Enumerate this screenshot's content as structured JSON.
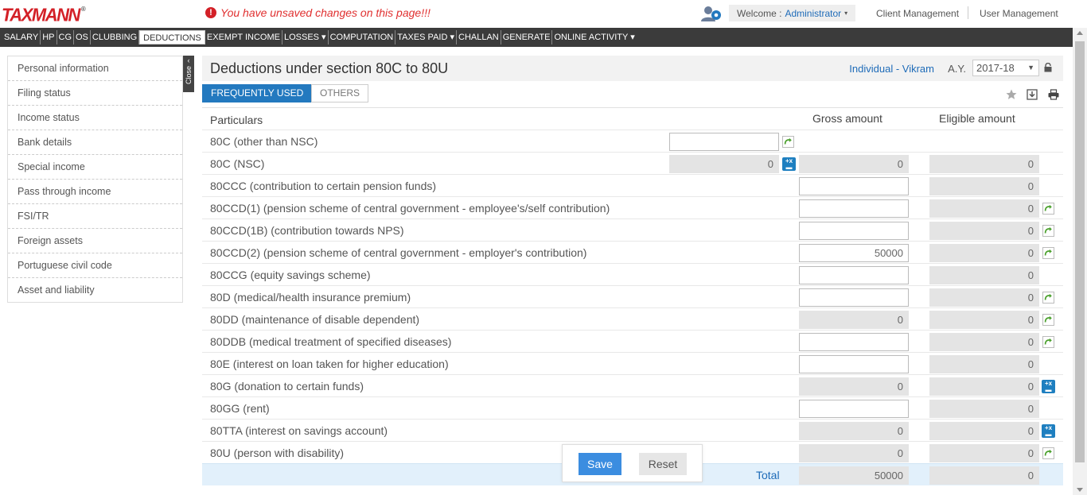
{
  "brand": {
    "logo": "TAXMANN",
    "reg": "®",
    "accent": "#d32027"
  },
  "header": {
    "warning": "You have unsaved changes on this page!!!",
    "welcome_prefix": "Welcome :",
    "user": "Administrator",
    "links": [
      "Client Management",
      "User Management"
    ]
  },
  "nav": {
    "items": [
      "SALARY",
      "HP",
      "CG",
      "OS",
      "CLUBBING",
      "DEDUCTIONS",
      "EXEMPT INCOME",
      "LOSSES ▾",
      "COMPUTATION",
      "TAXES PAID ▾",
      "CHALLAN",
      "GENERATE",
      "ONLINE ACTIVITY ▾"
    ],
    "active": "DEDUCTIONS"
  },
  "sidebar": {
    "items": [
      "Personal information",
      "Filing status",
      "Income status",
      "Bank details",
      "Special income",
      "Pass through income",
      "FSI/TR",
      "Foreign assets",
      "Portuguese civil code",
      "Asset and liability"
    ],
    "close_label": "Close"
  },
  "main": {
    "title": "Deductions under section 80C to 80U",
    "assessee": "Individual - Vikram",
    "ay_label": "A.Y.",
    "ay_value": "2017-18",
    "tabs": [
      "FREQUENTLY USED",
      "OTHERS"
    ]
  },
  "table": {
    "headers": {
      "particulars": "Particulars",
      "gross": "Gross amount",
      "eligible": "Eligible amount"
    },
    "rows": [
      {
        "label": "80C (other than NSC)",
        "claim": "",
        "gross": null,
        "eligible": null
      },
      {
        "label": "80C (NSC)",
        "claim": "0",
        "gross": "0",
        "eligible": "0"
      },
      {
        "label": "80CCC (contribution to certain pension funds)",
        "gross": "",
        "eligible": "0"
      },
      {
        "label": "80CCD(1) (pension scheme of central government - employee's/self contribution)",
        "gross": "",
        "eligible": "0"
      },
      {
        "label": "80CCD(1B) (contribution towards NPS)",
        "gross": "",
        "eligible": "0"
      },
      {
        "label": "80CCD(2) (pension scheme of central government - employer's contribution)",
        "gross": "50000",
        "eligible": "0"
      },
      {
        "label": "80CCG (equity savings scheme)",
        "gross": "",
        "eligible": "0"
      },
      {
        "label": "80D (medical/health insurance premium)",
        "gross": "",
        "eligible": "0"
      },
      {
        "label": "80DD (maintenance of disable dependent)",
        "gross": "0",
        "eligible": "0"
      },
      {
        "label": "80DDB (medical treatment of specified diseases)",
        "gross": "",
        "eligible": "0"
      },
      {
        "label": "80E (interest on loan taken for higher education)",
        "gross": "",
        "eligible": "0"
      },
      {
        "label": "80G (donation to certain funds)",
        "gross": "0",
        "eligible": "0"
      },
      {
        "label": "80GG (rent)",
        "gross": "",
        "eligible": "0"
      },
      {
        "label": "80TTA (interest on savings account)",
        "gross": "0",
        "eligible": "0"
      },
      {
        "label": "80U (person with disability)",
        "gross": "0",
        "eligible": "0"
      }
    ],
    "total": {
      "label": "Total",
      "gross": "50000",
      "eligible": "0"
    }
  },
  "actions": {
    "save": "Save",
    "reset": "Reset"
  }
}
